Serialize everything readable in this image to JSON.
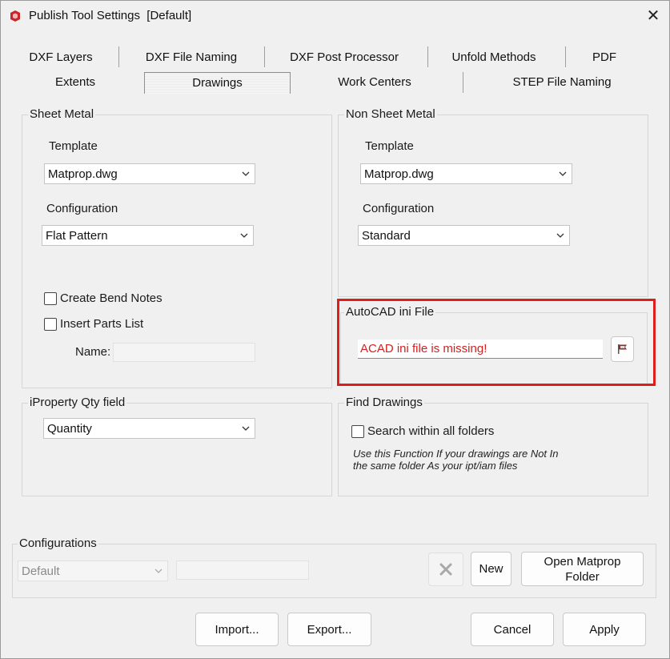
{
  "window": {
    "title": "Publish Tool Settings  [Default]",
    "app_icon": "inventor-app-icon",
    "close_glyph": "✕"
  },
  "tabs_row1": [
    "DXF Layers",
    "DXF File Naming",
    "DXF Post Processor",
    "Unfold Methods",
    "PDF"
  ],
  "tabs_row2": [
    "Extents",
    "Drawings",
    "Work Centers",
    "STEP File Naming"
  ],
  "selected_tab": "Drawings",
  "sheet_metal": {
    "group_label": "Sheet Metal",
    "template_label": "Template",
    "template_value": "Matprop.dwg",
    "configuration_label": "Configuration",
    "configuration_value": "Flat Pattern",
    "create_bend_notes_label": "Create Bend Notes",
    "create_bend_notes_checked": false,
    "insert_parts_list_label": "Insert Parts List",
    "insert_parts_list_checked": false,
    "name_label": "Name:",
    "name_value": ""
  },
  "non_sheet_metal": {
    "group_label": "Non Sheet Metal",
    "template_label": "Template",
    "template_value": "Matprop.dwg",
    "configuration_label": "Configuration",
    "configuration_value": "Standard"
  },
  "autocad_ini": {
    "group_label": "AutoCAD ini File",
    "value": "ACAD ini file is missing!",
    "value_color": "#d42020",
    "highlight_color": "#e01d1d",
    "browse_icon": "flag-folder-icon"
  },
  "iproperty": {
    "group_label": "iProperty Qty field",
    "value": "Quantity"
  },
  "find_drawings": {
    "group_label": "Find Drawings",
    "search_label": "Search within all folders",
    "search_checked": false,
    "note_line1": "Use this Function If your drawings are Not In",
    "note_line2": "the same folder As your ipt/iam files"
  },
  "configurations": {
    "group_label": "Configurations",
    "selected": "Default",
    "name_value": "",
    "delete_icon": "delete-x-icon",
    "new_label": "New",
    "open_matprop_line1": "Open Matprop",
    "open_matprop_line2": "Folder"
  },
  "footer": {
    "import_label": "Import...",
    "export_label": "Export...",
    "cancel_label": "Cancel",
    "apply_label": "Apply"
  }
}
